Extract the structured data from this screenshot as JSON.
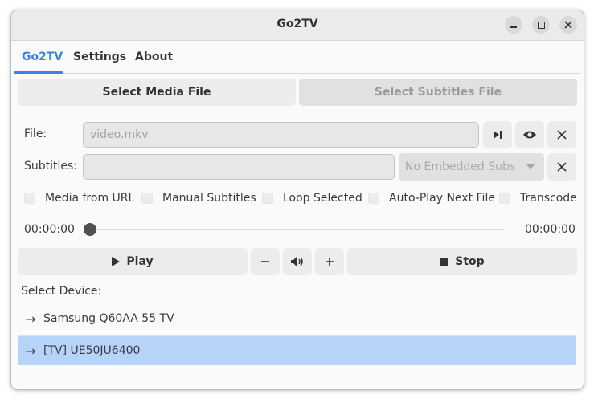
{
  "window": {
    "title": "Go2TV"
  },
  "tabs": [
    {
      "label": "Go2TV",
      "active": true
    },
    {
      "label": "Settings",
      "active": false
    },
    {
      "label": "About",
      "active": false
    }
  ],
  "buttons": {
    "select_media": "Select Media File",
    "select_subs": "Select Subtitles File",
    "play": "Play",
    "stop": "Stop"
  },
  "file": {
    "label": "File:",
    "value": "video.mkv"
  },
  "subtitles": {
    "label": "Subtitles:",
    "value": "",
    "embedded": "No Embedded Subs"
  },
  "checkboxes": [
    {
      "label": "Media from URL",
      "checked": false
    },
    {
      "label": "Manual Subtitles",
      "checked": false
    },
    {
      "label": "Loop Selected",
      "checked": false
    },
    {
      "label": "Auto-Play Next File",
      "checked": false
    },
    {
      "label": "Transcode",
      "checked": false
    }
  ],
  "playback": {
    "current_time": "00:00:00",
    "total_time": "00:00:00",
    "progress": 0
  },
  "devices": {
    "label": "Select Device:",
    "items": [
      {
        "name": "Samsung Q60AA 55 TV",
        "selected": false
      },
      {
        "name": "[TV] UE50JU6400",
        "selected": true
      }
    ]
  },
  "icons": {
    "minimize": "minimize-icon",
    "maximize": "maximize-icon",
    "close": "close-icon",
    "next": "skip-next-icon",
    "preview": "eye-icon",
    "clear": "x-icon",
    "play": "play-icon",
    "stop": "stop-icon",
    "volume": "speaker-icon",
    "volume_down": "minus-icon",
    "volume_up": "plus-icon",
    "arrow": "arrow-right-icon"
  },
  "colors": {
    "accent": "#3584e4",
    "selected_row": "#b6d3fa"
  }
}
